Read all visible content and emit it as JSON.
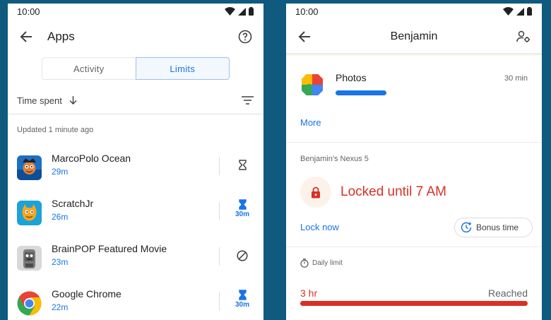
{
  "left": {
    "status_time": "10:00",
    "title": "Apps",
    "tabs": [
      "Activity",
      "Limits"
    ],
    "sort_label": "Time spent",
    "updated": "Updated 1 minute ago",
    "apps": [
      {
        "name": "MarcoPolo Ocean",
        "time": "29m",
        "limit": ""
      },
      {
        "name": "ScratchJr",
        "time": "26m",
        "limit": "30m"
      },
      {
        "name": "BrainPOP Featured Movie",
        "time": "23m",
        "limit": ""
      },
      {
        "name": "Google Chrome",
        "time": "22m",
        "limit": "30m"
      }
    ]
  },
  "right": {
    "status_time": "10:00",
    "title": "Benjamin",
    "app_name": "Photos",
    "app_time": "30 min",
    "more": "More",
    "device": "Benjamin's Nexus 5",
    "locked_text": "Locked until 7 AM",
    "lock_now": "Lock now",
    "bonus_time": "Bonus time",
    "daily_limit": "Daily limit",
    "limit_value": "3 hr",
    "reached": "Reached"
  },
  "colors": {
    "background": "#0f5a7e",
    "accent": "#1a73e8",
    "alert": "#d93025"
  }
}
